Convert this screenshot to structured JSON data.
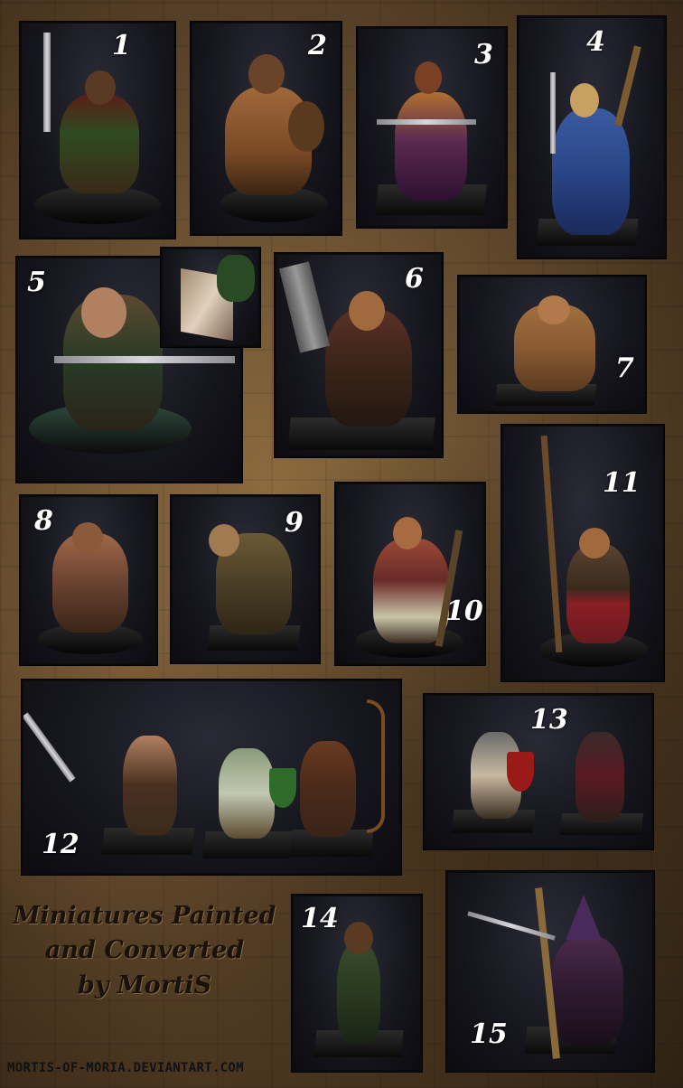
{
  "labels": [
    "1",
    "2",
    "3",
    "4",
    "5",
    "6",
    "7",
    "8",
    "9",
    "10",
    "11",
    "12",
    "13",
    "14",
    "15"
  ],
  "title": {
    "line1": "Miniatures Painted",
    "line2": "and Converted",
    "line3": "by MortiS"
  },
  "url": "MORTIS-OF-MORIA.DEVIANTART.COM",
  "colors": {
    "background": "#6b5030",
    "panel": "#15151c",
    "number": "#ffffff",
    "title": "#1a120a"
  }
}
